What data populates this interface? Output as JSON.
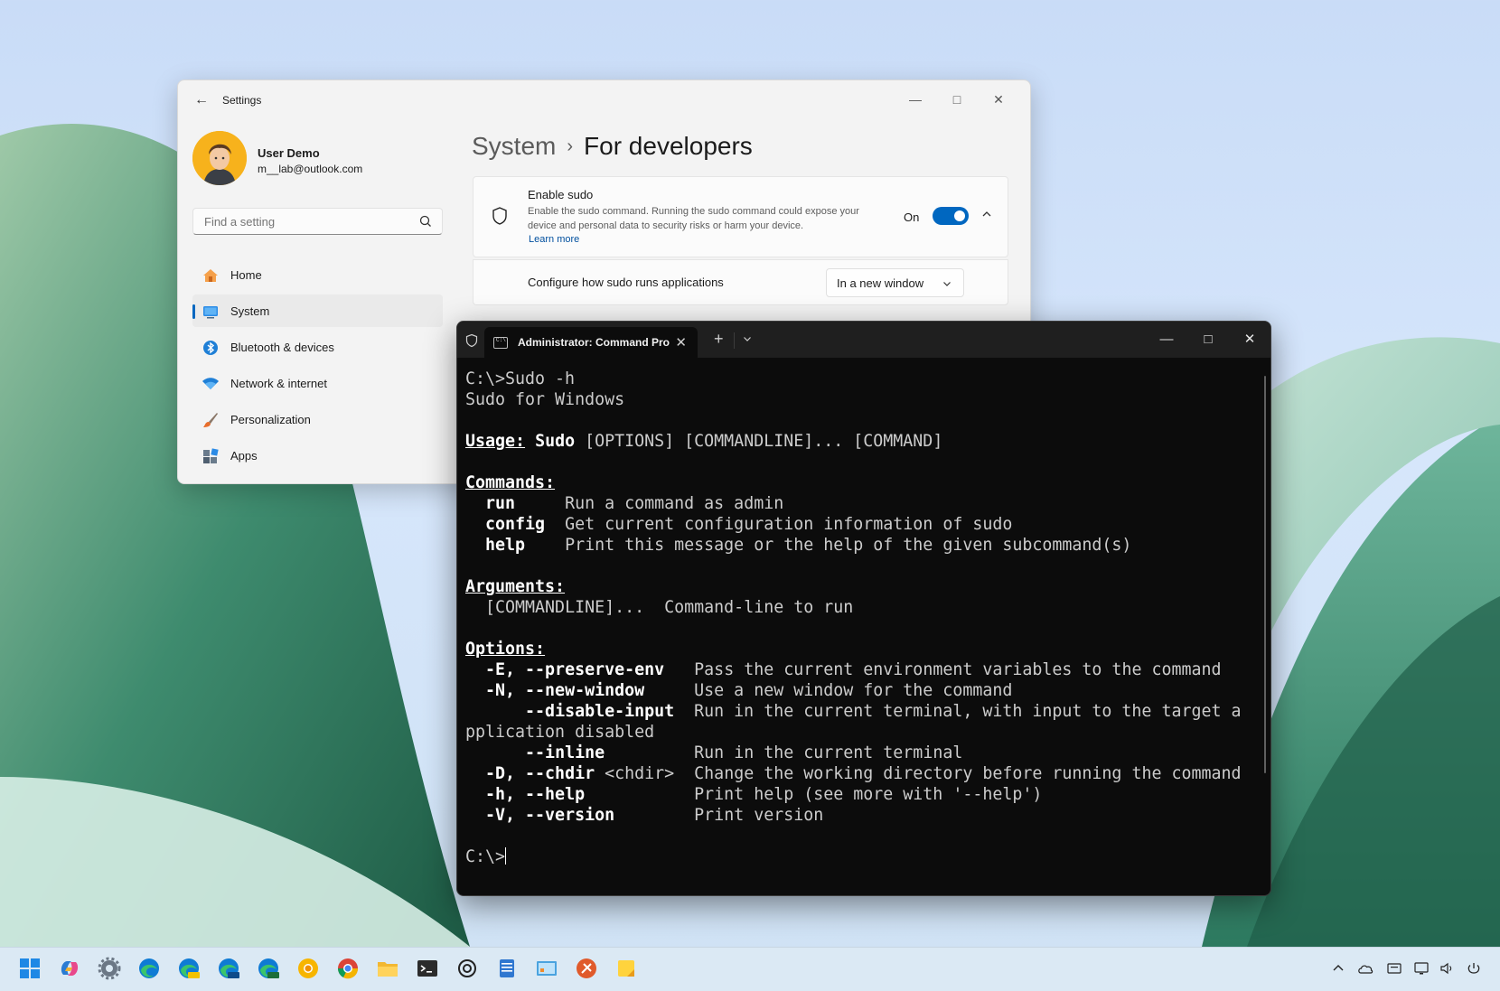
{
  "settings": {
    "title": "Settings",
    "user_name": "User Demo",
    "user_email": "m__lab@outlook.com",
    "search_placeholder": "Find a setting",
    "nav": [
      {
        "label": "Home",
        "icon": "home-icon"
      },
      {
        "label": "System",
        "icon": "system-icon",
        "selected": true
      },
      {
        "label": "Bluetooth & devices",
        "icon": "bluetooth-icon"
      },
      {
        "label": "Network & internet",
        "icon": "wifi-icon"
      },
      {
        "label": "Personalization",
        "icon": "brush-icon"
      },
      {
        "label": "Apps",
        "icon": "apps-icon"
      }
    ],
    "breadcrumb_parent": "System",
    "breadcrumb_current": "For developers",
    "sudo_title": "Enable sudo",
    "sudo_desc": "Enable the sudo command. Running the sudo command could expose your device and personal data to security risks or harm your device.",
    "learn_more": "Learn more",
    "toggle_label": "On",
    "toggle_on": true,
    "configure_label": "Configure how sudo runs applications",
    "configure_value": "In a new window"
  },
  "terminal": {
    "tab_title": "Administrator: Command Pro",
    "lines": {
      "l1": "C:\\>Sudo -h",
      "l2": "Sudo for Windows",
      "usage_h": "Usage:",
      "usage_cmd": "Sudo",
      "usage_rest": " [OPTIONS] [COMMANDLINE]... [COMMAND]",
      "commands_h": "Commands:",
      "c_run": "run",
      "c_run_d": "Run a command as admin",
      "c_config": "config",
      "c_config_d": "Get current configuration information of sudo",
      "c_help": "help",
      "c_help_d": "Print this message or the help of the given subcommand(s)",
      "arguments_h": "Arguments:",
      "a_cmdline": "[COMMANDLINE]...",
      "a_cmdline_d": "Command-line to run",
      "options_h": "Options:",
      "o1": "-E, --preserve-env",
      "o1_d": "Pass the current environment variables to the command",
      "o2": "-N, --new-window",
      "o2_d": "Use a new window for the command",
      "o3": "--disable-input",
      "o3_d": "Run in the current terminal, with input to the target a",
      "o3_wrap": "pplication disabled",
      "o4": "--inline",
      "o4_d": "Run in the current terminal",
      "o5": "-D, --chdir",
      "o5_arg": " <chdir>",
      "o5_d": "Change the working directory before running the command",
      "o6": "-h, --help",
      "o6_d": "Print help (see more with '--help')",
      "o7": "-V, --version",
      "o7_d": "Print version",
      "prompt": "C:\\>"
    }
  },
  "taskbar": {
    "apps": [
      "start-icon",
      "copilot-icon",
      "settings-gear-icon",
      "edge-icon",
      "edge-canary-icon",
      "edge-beta-icon",
      "edge-dev-icon",
      "chrome-canary-icon",
      "chrome-icon",
      "file-explorer-icon",
      "terminal-icon",
      "chatgpt-icon",
      "notepad-icon",
      "control-panel-icon",
      "app-orange-icon",
      "sticky-notes-icon"
    ],
    "tray": [
      "chevron-up-icon",
      "onedrive-icon",
      "language-icon",
      "network-icon",
      "volume-icon",
      "power-icon"
    ]
  },
  "colors": {
    "accent": "#0067c0",
    "terminal_bg": "#0c0c0c",
    "taskbar_bg": "#dbe9f4"
  }
}
